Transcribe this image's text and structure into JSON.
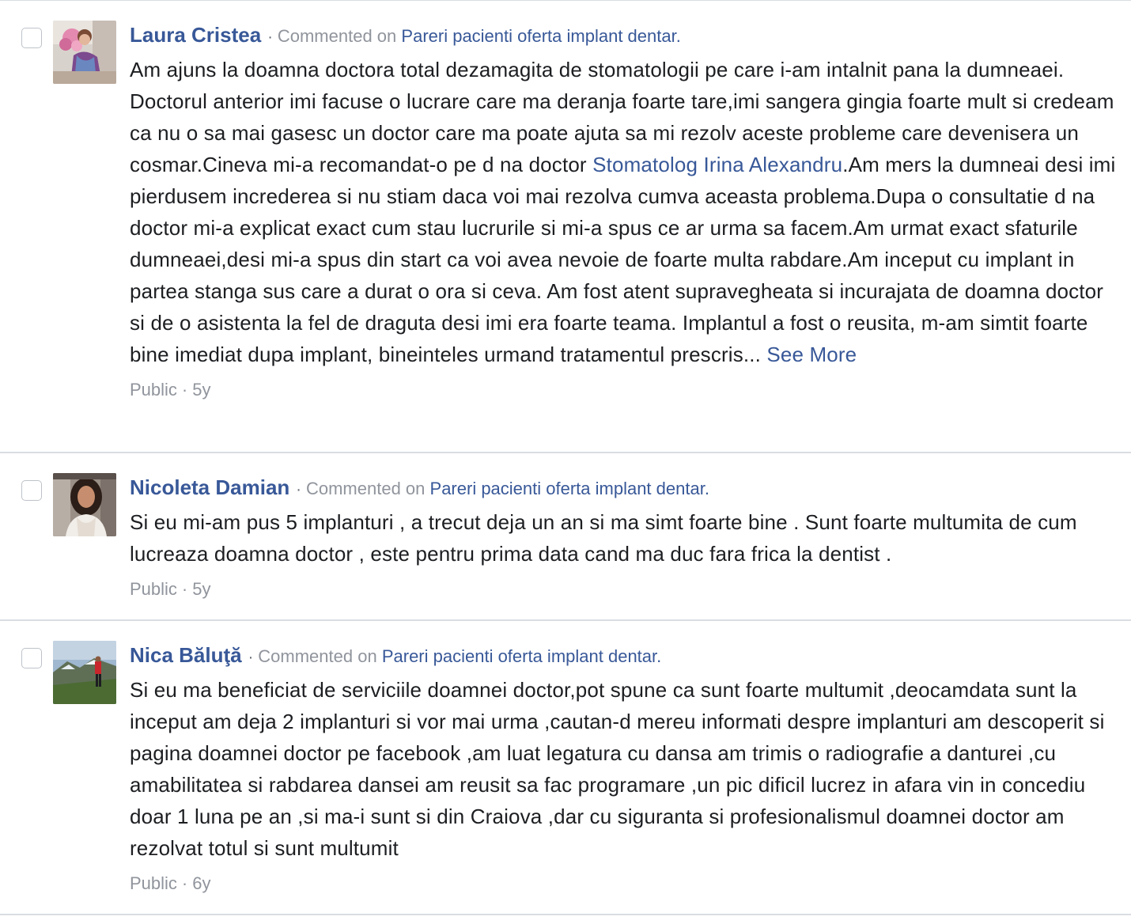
{
  "comments": [
    {
      "author": "Laura Cristea",
      "separator": "·",
      "action": "Commented on",
      "post_title": "Pareri pacienti oferta implant dentar.",
      "text_before_link": "Am ajuns la doamna doctora total dezamagita de stomatologii pe care i-am intalnit pana la dumneaei. Doctorul anterior imi facuse o lucrare care ma deranja foarte tare,imi sangera gingia foarte mult si credeam ca nu o sa mai gasesc un doctor care ma poate ajuta sa mi rezolv aceste probleme care devenisera un cosmar.Cineva mi-a recomandat-o pe d na doctor ",
      "link_text": "Stomatolog Irina Alexandru",
      "text_after_link": ".Am mers la dumneai desi imi pierdusem increderea si nu stiam daca voi mai rezolva cumva aceasta problema.Dupa o consultatie d na doctor mi-a explicat exact cum stau lucrurile si mi-a spus ce ar urma sa facem.Am urmat exact sfaturile dumneaei,desi mi-a spus din start ca voi avea nevoie de foarte multa rabdare.Am inceput cu implant in partea stanga sus care a durat o ora si ceva. Am fost atent supravegheata si incurajata de doamna doctor si de o asistenta la fel de draguta desi imi era foarte teama. Implantul a fost o reusita, m-am simtit foarte bine imediat dupa implant, bineinteles urmand tratamentul prescris... ",
      "see_more": "See More",
      "audience": "Public",
      "meta_dot": "·",
      "age": "5y"
    },
    {
      "author": "Nicoleta Damian",
      "separator": "·",
      "action": "Commented on",
      "post_title": "Pareri pacienti oferta implant dentar.",
      "text": "Si eu mi-am pus 5 implanturi , a trecut deja un an si ma simt foarte bine . Sunt foarte multumita de cum lucreaza doamna doctor , este pentru prima data cand ma duc fara frica la dentist .",
      "audience": "Public",
      "meta_dot": "·",
      "age": "5y"
    },
    {
      "author": "Nica Băluţă",
      "separator": "·",
      "action": "Commented on",
      "post_title": "Pareri pacienti oferta implant dentar.",
      "text": "Si eu ma beneficiat de serviciile doamnei doctor,pot spune ca sunt foarte multumit ,deocamdata sunt la inceput am deja 2 implanturi si vor mai urma ,cautan-d mereu informati despre implanturi am descoperit si pagina doamnei doctor pe facebook ,am luat legatura cu dansa am trimis o radiografie a danturei ,cu amabilitatea si rabdarea dansei am reusit sa fac programare ,un pic dificil lucrez in afara vin in concediu doar 1 luna pe an ,si ma-i sunt si din Craiova ,dar cu siguranta si profesionalismul doamnei doctor am rezolvat totul si sunt multumit",
      "audience": "Public",
      "meta_dot": "·",
      "age": "6y"
    }
  ],
  "colors": {
    "link": "#385898",
    "muted": "#90949c",
    "text": "#1c1e21",
    "divider": "#dadde1"
  }
}
